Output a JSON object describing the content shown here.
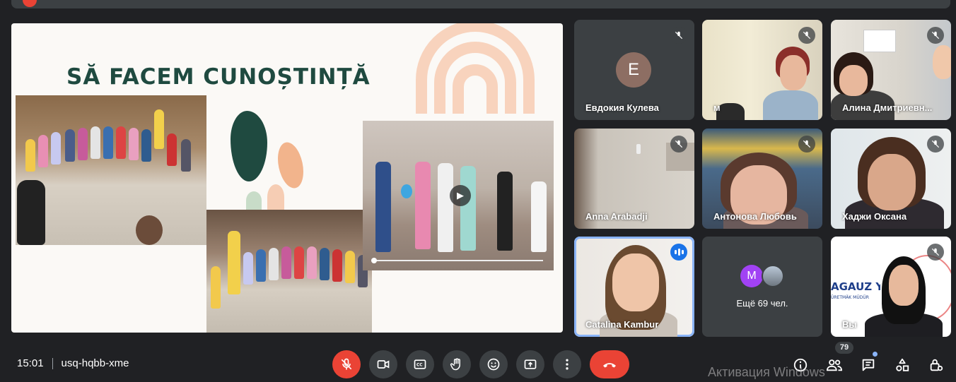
{
  "meeting": {
    "time": "15:01",
    "code": "usq-hqbb-xme"
  },
  "presentation": {
    "title": "SĂ FACEM CUNOȘTINȚĂ"
  },
  "participants": [
    {
      "name": "Евдокия Кулева",
      "avatar_letter": "E",
      "muted": true
    },
    {
      "name": "м",
      "muted": true
    },
    {
      "name": "Алина Дмитриевн...",
      "muted": true
    },
    {
      "name": "Anna Arabadji",
      "muted": true
    },
    {
      "name": "Антонова Любовь",
      "muted": true
    },
    {
      "name": "Хаджи Оксана",
      "muted": true
    },
    {
      "name": "Catalina Kambur",
      "muted": false,
      "speaking": true
    },
    {
      "name": "Вы",
      "muted": true
    }
  ],
  "more_participants": {
    "label": "Ещё 69 чел.",
    "avatar_letter": "M"
  },
  "controls": {
    "participant_count": "79"
  },
  "watermark": "Активация Windows",
  "colors": {
    "background": "#202124",
    "tile": "#3c4043",
    "danger": "#ea4335",
    "accent": "#8ab4f8",
    "slide_title": "#1f4a40"
  },
  "icons": [
    "mic-off-icon",
    "videocam-icon",
    "captions-icon",
    "raise-hand-icon",
    "emoji-icon",
    "present-icon",
    "more-vert-icon",
    "call-end-icon",
    "info-icon",
    "people-icon",
    "chat-icon",
    "activities-icon",
    "host-controls-icon",
    "play-icon"
  ]
}
